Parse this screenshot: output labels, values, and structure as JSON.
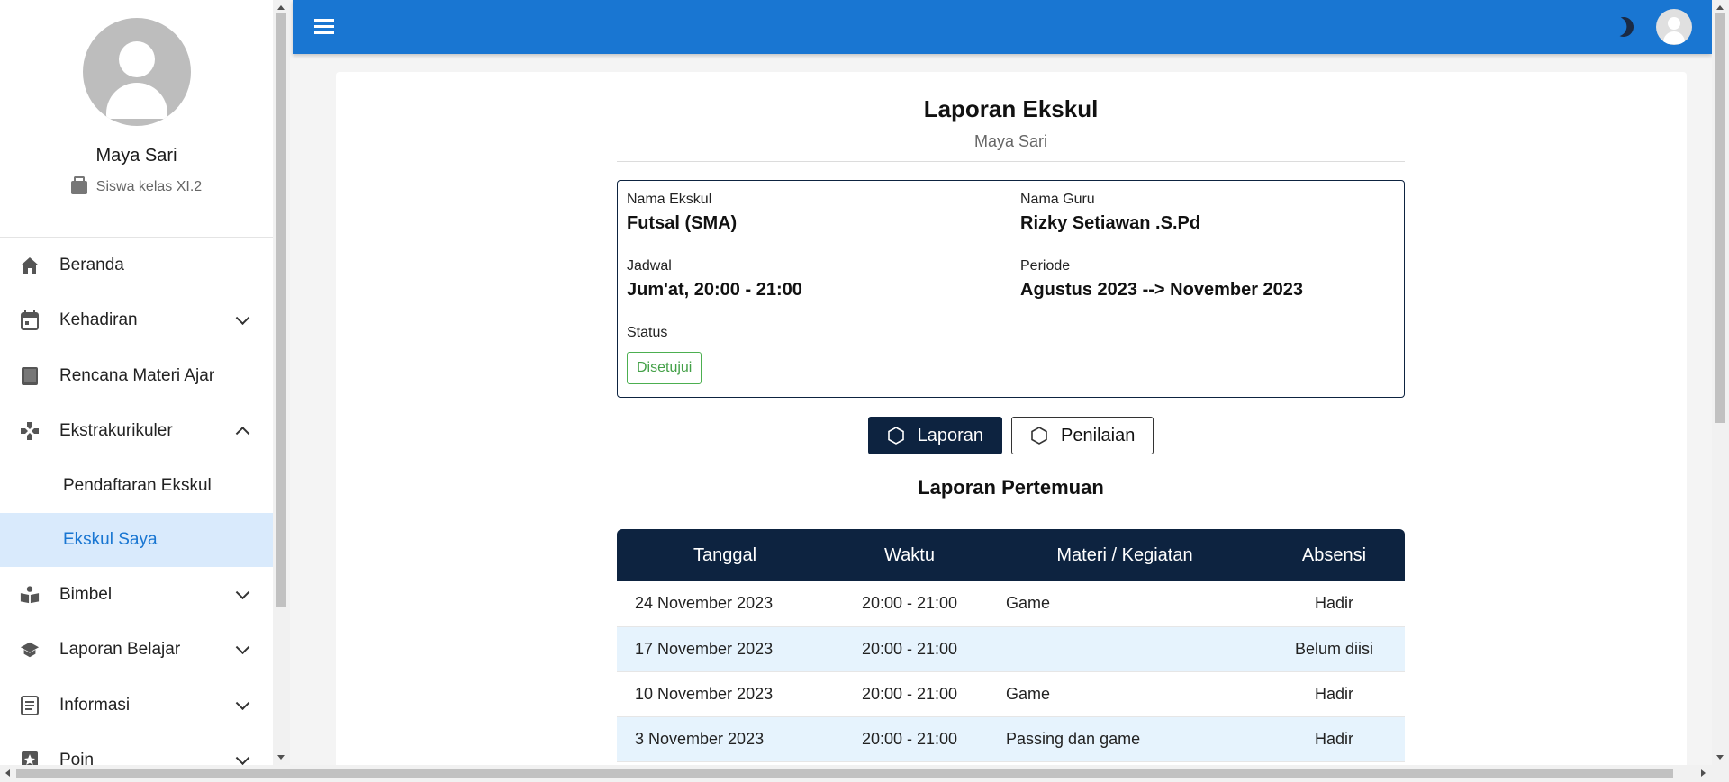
{
  "profile": {
    "name": "Maya Sari",
    "role": "Siswa kelas XI.2"
  },
  "nav": {
    "beranda": "Beranda",
    "kehadiran": "Kehadiran",
    "rencana": "Rencana Materi Ajar",
    "ekstrakurikuler": "Ekstrakurikuler",
    "pendaftaran": "Pendaftaran Ekskul",
    "ekskul_saya": "Ekskul Saya",
    "bimbel": "Bimbel",
    "laporan_belajar": "Laporan Belajar",
    "informasi": "Informasi",
    "poin": "Poin"
  },
  "page": {
    "title": "Laporan Ekskul",
    "subtitle": "Maya Sari"
  },
  "info": {
    "nama_ekskul_label": "Nama Ekskul",
    "nama_ekskul": "Futsal (SMA)",
    "nama_guru_label": "Nama Guru",
    "nama_guru": "Rizky Setiawan .S.Pd",
    "jadwal_label": "Jadwal",
    "jadwal": "Jum'at, 20:00 - 21:00",
    "periode_label": "Periode",
    "periode": "Agustus 2023 --> November 2023",
    "status_label": "Status",
    "status": "Disetujui"
  },
  "buttons": {
    "laporan": "Laporan",
    "penilaian": "Penilaian"
  },
  "section_title": "Laporan Pertemuan",
  "table": {
    "headers": [
      "Tanggal",
      "Waktu",
      "Materi / Kegiatan",
      "Absensi"
    ],
    "rows": [
      [
        "24 November 2023",
        "20:00 - 21:00",
        "Game",
        "Hadir"
      ],
      [
        "17 November 2023",
        "20:00 - 21:00",
        "",
        "Belum diisi"
      ],
      [
        "10 November 2023",
        "20:00 - 21:00",
        "Game",
        "Hadir"
      ],
      [
        "3 November 2023",
        "20:00 - 21:00",
        "Passing dan game",
        "Hadir"
      ]
    ]
  },
  "colors": {
    "primary": "#1976d2",
    "dark": "#0d2340",
    "success": "#43a047",
    "active_bg": "#d9eafc"
  },
  "icons": {
    "menu": "hamburger-icon",
    "theme": "moon-icon",
    "account": "account-icon",
    "beranda": "home-icon",
    "kehadiran": "calendar-icon",
    "rencana": "book-icon",
    "ekstrakurikuler": "gamepad-icon",
    "bimbel": "reading-icon",
    "laporan_belajar": "graduation-cap-icon",
    "informasi": "article-icon",
    "poin": "star-box-icon"
  }
}
